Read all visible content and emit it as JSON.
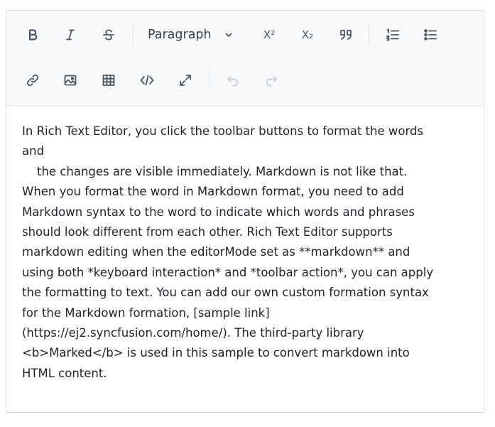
{
  "toolbar": {
    "format_dropdown": "Paragraph",
    "superscript_label": "X²",
    "subscript_label": "X₂"
  },
  "content": {
    "text": "In Rich Text Editor, you click the toolbar buttons to format the words\nand\n    the changes are visible immediately. Markdown is not like that.\nWhen you format the word in Markdown format, you need to add\nMarkdown syntax to the word to indicate which words and phrases\nshould look different from each other. Rich Text Editor supports\nmarkdown editing when the editorMode set as **markdown** and\nusing both *keyboard interaction* and *toolbar action*, you can apply\nthe formatting to text. You can add our own custom formation syntax\nfor the Markdown formation, [sample link]\n(https://ej2.syncfusion.com/home/). The third-party library\n<b>Marked</b> is used in this sample to convert markdown into\nHTML content."
  },
  "icons": {
    "row1": [
      "bold-icon",
      "italic-icon",
      "strikethrough-icon",
      "superscript-icon",
      "subscript-icon",
      "blockquote-icon",
      "ordered-list-icon",
      "unordered-list-icon"
    ],
    "row2": [
      "link-icon",
      "image-icon",
      "table-icon",
      "code-icon",
      "fullscreen-icon",
      "undo-icon",
      "redo-icon"
    ]
  }
}
